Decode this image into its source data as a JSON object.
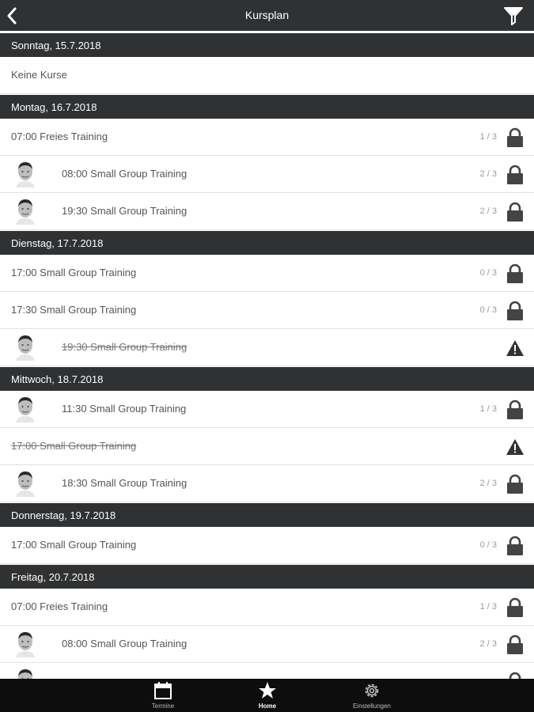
{
  "header": {
    "title": "Kursplan",
    "back_icon": "chevron-left-icon",
    "filter_icon": "filter-icon"
  },
  "days": [
    {
      "date": "Sonntag, 15.7.2018",
      "courses": [
        {
          "label": "Keine Kurse",
          "avatar": false,
          "count": "",
          "icon": "none",
          "cancelled": false
        }
      ]
    },
    {
      "date": "Montag, 16.7.2018",
      "courses": [
        {
          "label": "07:00 Freies Training",
          "avatar": false,
          "count": "1 / 3",
          "icon": "lock",
          "cancelled": false
        },
        {
          "label": "08:00 Small Group Training",
          "avatar": true,
          "count": "2 / 3",
          "icon": "lock",
          "cancelled": false
        },
        {
          "label": "19:30 Small Group Training",
          "avatar": true,
          "count": "2 / 3",
          "icon": "lock",
          "cancelled": false
        }
      ]
    },
    {
      "date": "Dienstag, 17.7.2018",
      "courses": [
        {
          "label": "17:00 Small Group Training",
          "avatar": false,
          "count": "0 / 3",
          "icon": "lock",
          "cancelled": false
        },
        {
          "label": "17:30 Small Group Training",
          "avatar": false,
          "count": "0 / 3",
          "icon": "lock",
          "cancelled": false
        },
        {
          "label": "19:30 Small Group Training",
          "avatar": true,
          "count": "",
          "icon": "warning",
          "cancelled": true
        }
      ]
    },
    {
      "date": "Mittwoch, 18.7.2018",
      "courses": [
        {
          "label": "11:30 Small Group Training",
          "avatar": true,
          "count": "1 / 3",
          "icon": "lock",
          "cancelled": false
        },
        {
          "label": "17:00 Small Group Training",
          "avatar": false,
          "count": "",
          "icon": "warning",
          "cancelled": true
        },
        {
          "label": "18:30 Small Group Training",
          "avatar": true,
          "count": "2 / 3",
          "icon": "lock",
          "cancelled": false
        }
      ]
    },
    {
      "date": "Donnerstag, 19.7.2018",
      "courses": [
        {
          "label": "17:00 Small Group Training",
          "avatar": false,
          "count": "0 / 3",
          "icon": "lock",
          "cancelled": false
        }
      ]
    },
    {
      "date": "Freitag, 20.7.2018",
      "courses": [
        {
          "label": "07:00 Freies Training",
          "avatar": false,
          "count": "1 / 3",
          "icon": "lock",
          "cancelled": false
        },
        {
          "label": "08:00 Small Group Training",
          "avatar": true,
          "count": "2 / 3",
          "icon": "lock",
          "cancelled": false
        },
        {
          "label": "",
          "avatar": true,
          "count": "",
          "icon": "lock",
          "cancelled": false
        }
      ]
    }
  ],
  "tabs": [
    {
      "label": "Termine",
      "icon": "calendar-icon",
      "active": false
    },
    {
      "label": "Home",
      "icon": "star-icon",
      "active": true
    },
    {
      "label": "Einstellungen",
      "icon": "gear-icon",
      "active": false
    }
  ],
  "colors": {
    "bar": "#2f3133",
    "bottom_bar": "#0d0d0d",
    "icon": "#444444"
  }
}
